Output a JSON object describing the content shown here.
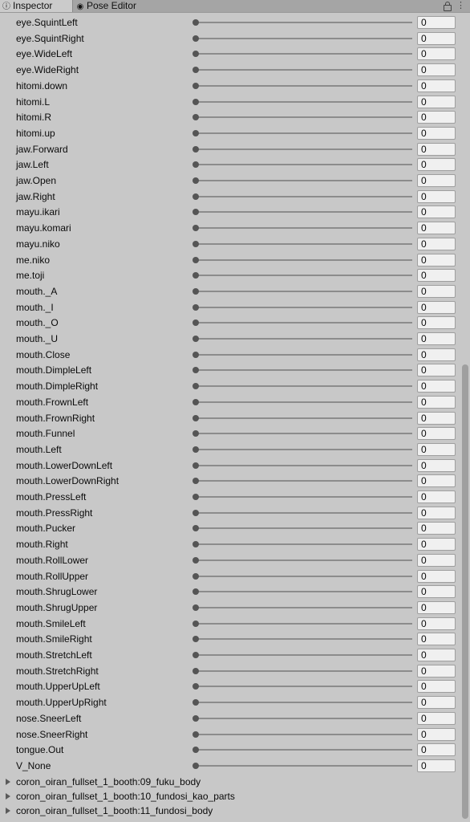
{
  "tabs": {
    "inspector": "Inspector",
    "pose_editor": "Pose Editor"
  },
  "blendshapes": [
    {
      "name": "eye.SquintLeft",
      "value": "0"
    },
    {
      "name": "eye.SquintRight",
      "value": "0"
    },
    {
      "name": "eye.WideLeft",
      "value": "0"
    },
    {
      "name": "eye.WideRight",
      "value": "0"
    },
    {
      "name": "hitomi.down",
      "value": "0"
    },
    {
      "name": "hitomi.L",
      "value": "0"
    },
    {
      "name": "hitomi.R",
      "value": "0"
    },
    {
      "name": "hitomi.up",
      "value": "0"
    },
    {
      "name": "jaw.Forward",
      "value": "0"
    },
    {
      "name": "jaw.Left",
      "value": "0"
    },
    {
      "name": "jaw.Open",
      "value": "0"
    },
    {
      "name": "jaw.Right",
      "value": "0"
    },
    {
      "name": "mayu.ikari",
      "value": "0"
    },
    {
      "name": "mayu.komari",
      "value": "0"
    },
    {
      "name": "mayu.niko",
      "value": "0"
    },
    {
      "name": "me.niko",
      "value": "0"
    },
    {
      "name": "me.toji",
      "value": "0"
    },
    {
      "name": "mouth._A",
      "value": "0"
    },
    {
      "name": "mouth._I",
      "value": "0"
    },
    {
      "name": "mouth._O",
      "value": "0"
    },
    {
      "name": "mouth._U",
      "value": "0"
    },
    {
      "name": "mouth.Close",
      "value": "0"
    },
    {
      "name": "mouth.DimpleLeft",
      "value": "0"
    },
    {
      "name": "mouth.DimpleRight",
      "value": "0"
    },
    {
      "name": "mouth.FrownLeft",
      "value": "0"
    },
    {
      "name": "mouth.FrownRight",
      "value": "0"
    },
    {
      "name": "mouth.Funnel",
      "value": "0"
    },
    {
      "name": "mouth.Left",
      "value": "0"
    },
    {
      "name": "mouth.LowerDownLeft",
      "value": "0"
    },
    {
      "name": "mouth.LowerDownRight",
      "value": "0"
    },
    {
      "name": "mouth.PressLeft",
      "value": "0"
    },
    {
      "name": "mouth.PressRight",
      "value": "0"
    },
    {
      "name": "mouth.Pucker",
      "value": "0"
    },
    {
      "name": "mouth.Right",
      "value": "0"
    },
    {
      "name": "mouth.RollLower",
      "value": "0"
    },
    {
      "name": "mouth.RollUpper",
      "value": "0"
    },
    {
      "name": "mouth.ShrugLower",
      "value": "0"
    },
    {
      "name": "mouth.ShrugUpper",
      "value": "0"
    },
    {
      "name": "mouth.SmileLeft",
      "value": "0"
    },
    {
      "name": "mouth.SmileRight",
      "value": "0"
    },
    {
      "name": "mouth.StretchLeft",
      "value": "0"
    },
    {
      "name": "mouth.StretchRight",
      "value": "0"
    },
    {
      "name": "mouth.UpperUpLeft",
      "value": "0"
    },
    {
      "name": "mouth.UpperUpRight",
      "value": "0"
    },
    {
      "name": "nose.SneerLeft",
      "value": "0"
    },
    {
      "name": "nose.SneerRight",
      "value": "0"
    },
    {
      "name": "tongue.Out",
      "value": "0"
    },
    {
      "name": "V_None",
      "value": "0"
    }
  ],
  "components": [
    "coron_oiran_fullset_1_booth:09_fuku_body",
    "coron_oiran_fullset_1_booth:10_fundosi_kao_parts",
    "coron_oiran_fullset_1_booth:11_fundosi_body"
  ],
  "icons": {
    "inspector_tab": "info-icon",
    "pose_editor_tab": "eye-icon",
    "lock": "lock-icon",
    "menu": "kebab-menu-icon",
    "foldout": "triangle-right-icon"
  }
}
